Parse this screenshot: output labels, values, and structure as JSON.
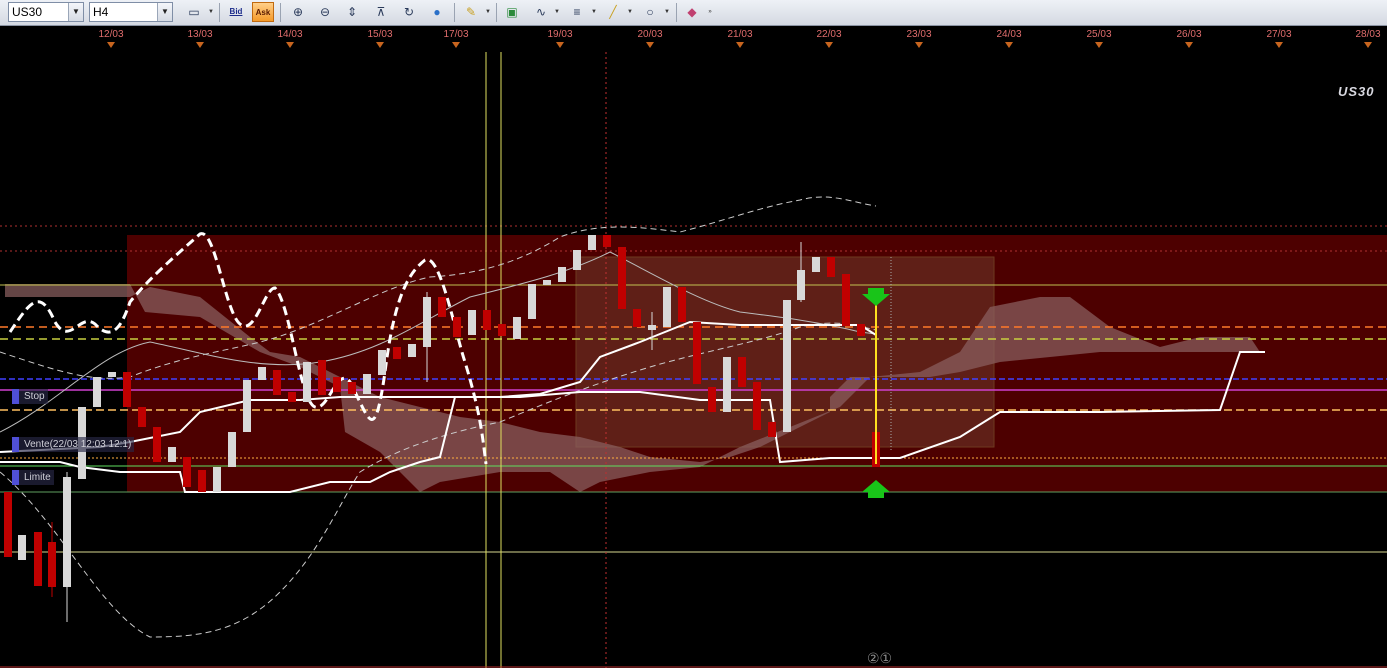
{
  "toolbar": {
    "symbol_value": "US30",
    "timeframe_value": "H4",
    "bid_label": "Bid",
    "ask_label": "Ask",
    "icons": [
      "chart-type-icon",
      "bid-icon",
      "ask-icon",
      "zoom-in-icon",
      "zoom-out-icon",
      "auto-scale-icon",
      "fit-icon",
      "refresh-icon",
      "globe-icon",
      "ruler-icon",
      "image-icon",
      "indicator-icon",
      "lines-icon",
      "draw-line-icon",
      "ellipse-icon",
      "eraser-icon",
      "more-icon"
    ]
  },
  "date_axis": {
    "labels": [
      "12/03",
      "13/03",
      "14/03",
      "15/03",
      "17/03",
      "19/03",
      "20/03",
      "21/03",
      "22/03",
      "23/03",
      "24/03",
      "25/03",
      "26/03",
      "27/03",
      "28/03"
    ]
  },
  "chart": {
    "instrument_label": "US30",
    "orders": {
      "stop_label": "Stop",
      "sell_label": "Vente(22/03 12:03 12:1)",
      "limit_label": "Limite"
    },
    "footer_glyph": "②①",
    "colors": {
      "background": "#000000",
      "zone": "#5a0000",
      "cloud": "#7a5a5a",
      "bull_candle": "#d8d8d8",
      "bear_candle": "#c00000",
      "white_line": "#ffffff",
      "orange_dash": "#ff7a2a",
      "yellow_dash": "#c8d040",
      "blue_line": "#4040ff",
      "magenta_line": "#d040d0",
      "green_arrow": "#19c419",
      "order_label": "#4f4fd6"
    }
  }
}
